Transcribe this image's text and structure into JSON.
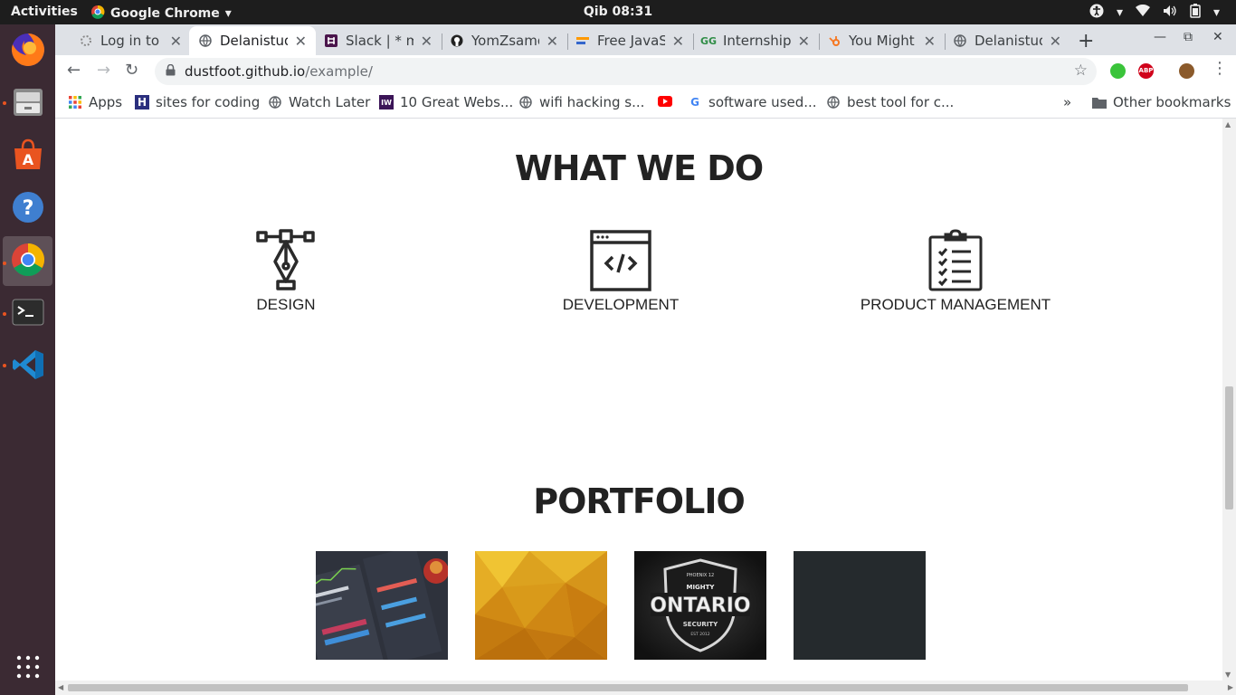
{
  "system": {
    "activities": "Activities",
    "app_name": "Google Chrome",
    "clock": "Qib 08:31"
  },
  "tabs": [
    {
      "title": "Log in to canvas",
      "favicon": "canvas-icon",
      "active": false
    },
    {
      "title": "Delanistudio",
      "favicon": "globe-icon",
      "active": true
    },
    {
      "title": "Slack | * mp",
      "favicon": "slack-icon",
      "active": false
    },
    {
      "title": "YomZsamora",
      "favicon": "github-icon",
      "active": false
    },
    {
      "title": "Free JavaScript",
      "favicon": "fcc-icon",
      "active": false
    },
    {
      "title": "Internships",
      "favicon": "gfg-icon",
      "active": false
    },
    {
      "title": "You Might",
      "favicon": "hubspot-icon",
      "active": false
    },
    {
      "title": "Delanistudio",
      "favicon": "globe-icon",
      "active": false
    }
  ],
  "omnibox": {
    "host": "dustfoot.github.io",
    "path": "/example/"
  },
  "bookmarks": {
    "items": [
      {
        "label": "Apps",
        "icon": "apps-grid-icon"
      },
      {
        "label": "sites for coding",
        "icon": "h-icon"
      },
      {
        "label": "Watch Later",
        "icon": "globe-icon"
      },
      {
        "label": "10 Great Webs...",
        "icon": "jw-icon"
      },
      {
        "label": "wifi hacking s...",
        "icon": "globe-icon"
      },
      {
        "label": "",
        "icon": "youtube-icon"
      },
      {
        "label": "software used...",
        "icon": "google-icon"
      },
      {
        "label": "best tool for c...",
        "icon": "globe-icon"
      }
    ],
    "overflow": "»",
    "other": "Other bookmarks"
  },
  "page": {
    "services_title": "WHAT WE DO",
    "services": [
      {
        "label": "DESIGN",
        "icon": "pen-nib-icon"
      },
      {
        "label": "DEVELOPMENT",
        "icon": "code-window-icon"
      },
      {
        "label": "PRODUCT MANAGEMENT",
        "icon": "clipboard-checklist-icon"
      }
    ],
    "portfolio_title": "PORTFOLIO",
    "portfolio": [
      {
        "name": "dashboard-ui",
        "color": "#2e323c"
      },
      {
        "name": "yellow-polygon",
        "color": "#e0a11e"
      },
      {
        "name": "mighty-ontario-security",
        "color": "#1a1a1a"
      },
      {
        "name": "dark-tile",
        "color": "#252a2d"
      }
    ],
    "portfolio_badge": {
      "top": "PHOENIX 12",
      "mid": "MIGHTY",
      "main": "ONTARIO",
      "sub": "SECURITY",
      "est": "EST 2012"
    }
  }
}
